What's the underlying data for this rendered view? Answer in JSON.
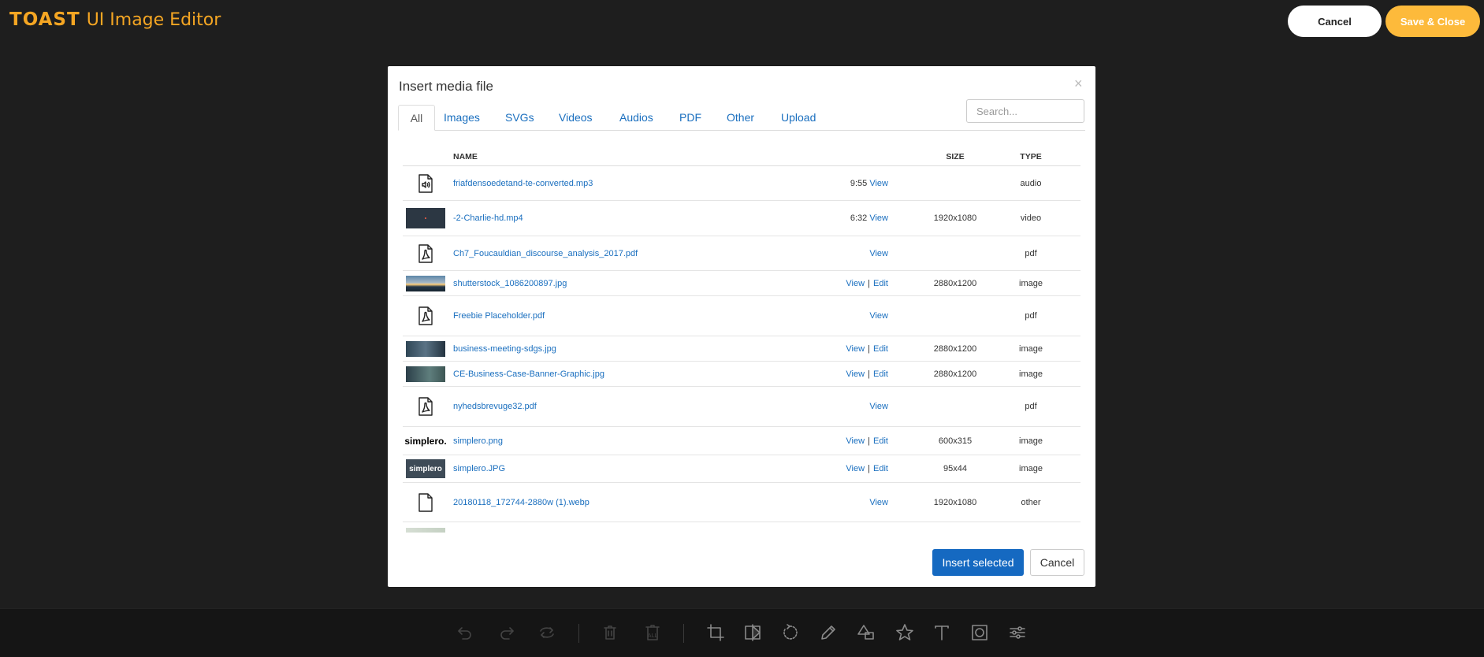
{
  "app": {
    "logo_brand": "TOAST",
    "logo_rest": "UI Image Editor",
    "cancel_label": "Cancel",
    "save_label": "Save & Close"
  },
  "modal": {
    "title": "Insert media file",
    "close_glyph": "×",
    "search_placeholder": "Search...",
    "tabs": [
      "All",
      "Images",
      "SVGs",
      "Videos",
      "Audios",
      "PDF",
      "Other",
      "Upload"
    ],
    "active_tab": "All",
    "columns": {
      "name": "NAME",
      "size": "SIZE",
      "type": "TYPE"
    },
    "insert_label": "Insert selected",
    "cancel_label": "Cancel"
  },
  "files": [
    {
      "name": "friafdensoedetand-te-converted.mp3",
      "duration": "9:55",
      "view": "View",
      "edit": "",
      "size": "",
      "type": "audio",
      "thumb": "audio-file-icon"
    },
    {
      "name": "-2-Charlie-hd.mp4",
      "duration": "6:32",
      "view": "View",
      "edit": "",
      "size": "1920x1080",
      "type": "video",
      "thumb": "video-thumbnail"
    },
    {
      "name": "Ch7_Foucauldian_discourse_analysis_2017.pdf",
      "duration": "",
      "view": "View",
      "edit": "",
      "size": "",
      "type": "pdf",
      "thumb": "pdf-file-icon"
    },
    {
      "name": "shutterstock_1086200897.jpg",
      "duration": "",
      "view": "View",
      "edit": "Edit",
      "size": "2880x1200",
      "type": "image",
      "thumb": "image-thumbnail"
    },
    {
      "name": "Freebie Placeholder.pdf",
      "duration": "",
      "view": "View",
      "edit": "",
      "size": "",
      "type": "pdf",
      "thumb": "pdf-file-icon"
    },
    {
      "name": "business-meeting-sdgs.jpg",
      "duration": "",
      "view": "View",
      "edit": "Edit",
      "size": "2880x1200",
      "type": "image",
      "thumb": "image-thumbnail"
    },
    {
      "name": "CE-Business-Case-Banner-Graphic.jpg",
      "duration": "",
      "view": "View",
      "edit": "Edit",
      "size": "2880x1200",
      "type": "image",
      "thumb": "image-thumbnail"
    },
    {
      "name": "nyhedsbrevuge32.pdf",
      "duration": "",
      "view": "View",
      "edit": "",
      "size": "",
      "type": "pdf",
      "thumb": "pdf-file-icon"
    },
    {
      "name": "simplero.png",
      "duration": "",
      "view": "View",
      "edit": "Edit",
      "size": "600x315",
      "type": "image",
      "thumb": "image-thumbnail"
    },
    {
      "name": "simplero.JPG",
      "duration": "",
      "view": "View",
      "edit": "Edit",
      "size": "95x44",
      "type": "image",
      "thumb": "image-thumbnail"
    },
    {
      "name": "20180118_172744-2880w (1).webp",
      "duration": "",
      "view": "View",
      "edit": "",
      "size": "1920x1080",
      "type": "other",
      "thumb": "file-icon"
    }
  ],
  "thumb_text": {
    "simplero_png": "simplero.",
    "simplero_jpg": "simplero"
  },
  "toolbar_icons": [
    "undo-icon",
    "redo-icon",
    "reset-icon",
    "delete-icon",
    "delete-all-icon",
    "crop-icon",
    "flip-icon",
    "rotate-icon",
    "draw-icon",
    "shape-icon",
    "icon-tool-icon",
    "text-icon",
    "mask-icon",
    "filter-icon"
  ],
  "toolbar_delete_all_text": "ALL",
  "colors": {
    "accent": "#1569c1",
    "save": "#fdba3b",
    "logo": "#f5a623",
    "background": "#1e1e1e"
  }
}
